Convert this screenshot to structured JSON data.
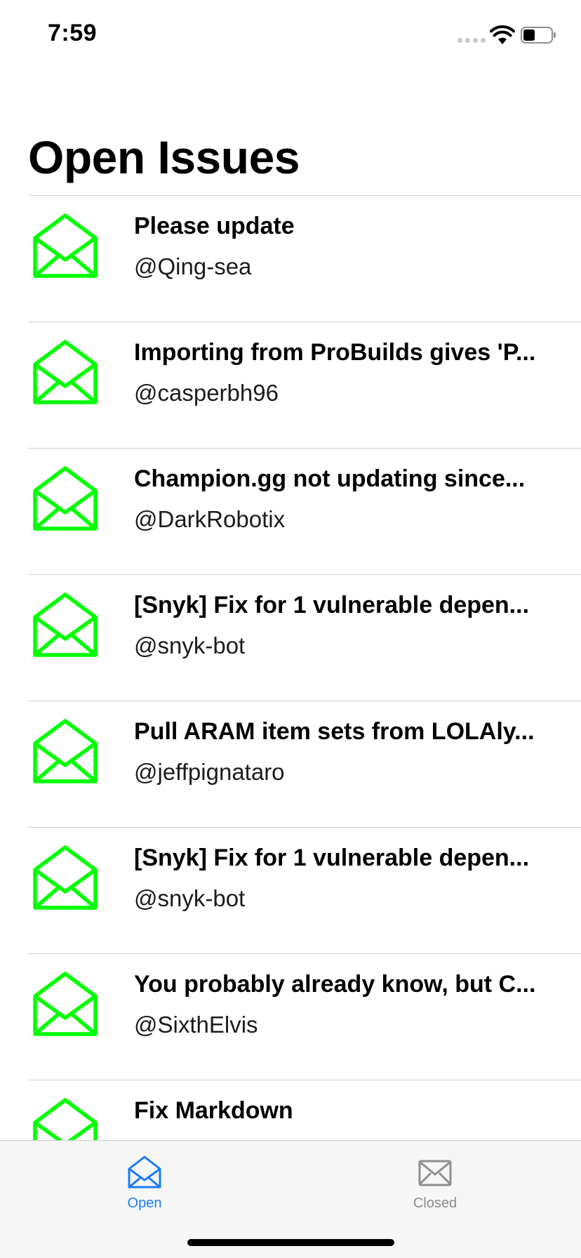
{
  "status_bar": {
    "time": "7:59"
  },
  "header": {
    "title": "Open Issues"
  },
  "colors": {
    "accent": "#1a7cf5",
    "icon_green": "#00ff00",
    "inactive": "#8e8e93"
  },
  "issues": [
    {
      "title": "Please update",
      "author": "@Qing-sea",
      "icon": "open-envelope-icon"
    },
    {
      "title": "Importing from ProBuilds gives 'P...",
      "author": "@casperbh96",
      "icon": "open-envelope-icon"
    },
    {
      "title": "Champion.gg not updating since...",
      "author": "@DarkRobotix",
      "icon": "open-envelope-icon"
    },
    {
      "title": "[Snyk] Fix for 1 vulnerable depen...",
      "author": "@snyk-bot",
      "icon": "open-envelope-icon"
    },
    {
      "title": "Pull ARAM item sets from LOLAly...",
      "author": "@jeffpignataro",
      "icon": "open-envelope-icon"
    },
    {
      "title": "[Snyk] Fix for 1 vulnerable depen...",
      "author": "@snyk-bot",
      "icon": "open-envelope-icon"
    },
    {
      "title": "You probably already know, but C...",
      "author": "@SixthElvis",
      "icon": "open-envelope-icon"
    },
    {
      "title": "Fix Markdown",
      "author": "",
      "icon": "open-envelope-icon"
    }
  ],
  "tab_bar": {
    "tabs": [
      {
        "label": "Open",
        "icon": "open-envelope-icon",
        "selected": true
      },
      {
        "label": "Closed",
        "icon": "closed-envelope-icon",
        "selected": false
      }
    ]
  }
}
